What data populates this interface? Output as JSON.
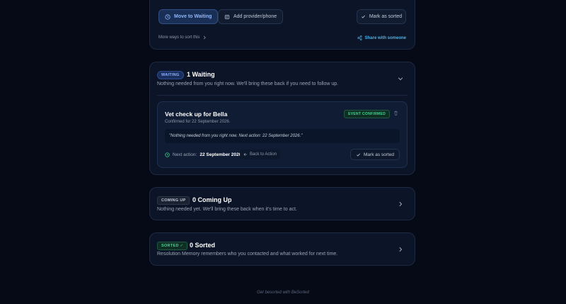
{
  "top_card": {
    "move_waiting_label": "Move to Waiting",
    "add_provider_label": "Add provider/phone",
    "mark_sorted_label": "Mark as sorted",
    "more_ways_label": "More ways to sort this",
    "share_label": "Share with someone"
  },
  "waiting": {
    "badge": "WAITING",
    "title": "1 Waiting",
    "description": "Nothing needed from you right now. We'll bring these back if you need to follow up.",
    "item": {
      "title": "Vet check up for Bella",
      "subtitle": "Confirmed for 22 September 2026.",
      "status_badge": "EVENT CONFIRMED",
      "quote": "\"Nothing needed from you right now. Next action: 22 September 2026.\"",
      "next_action_label": "Next action:",
      "next_action_date": "22 September 2026",
      "back_label": "Back to Action",
      "mark_sorted_label": "Mark as sorted"
    }
  },
  "coming_up": {
    "badge": "COMING UP",
    "title": "0 Coming Up",
    "description": "Nothing needed yet. We'll bring these back when it's time to act."
  },
  "sorted": {
    "badge": "SORTED ✓",
    "title": "0 Sorted",
    "description": "Resolution Memory remembers who you contacted and what worked for next time."
  },
  "footer": "Get besorted with BeSorted",
  "colors": {
    "background": "#060a17",
    "card": "#0c1528",
    "accent_blue": "#8db3ff",
    "accent_green": "#45d590",
    "share_link": "#4bb1e6"
  }
}
